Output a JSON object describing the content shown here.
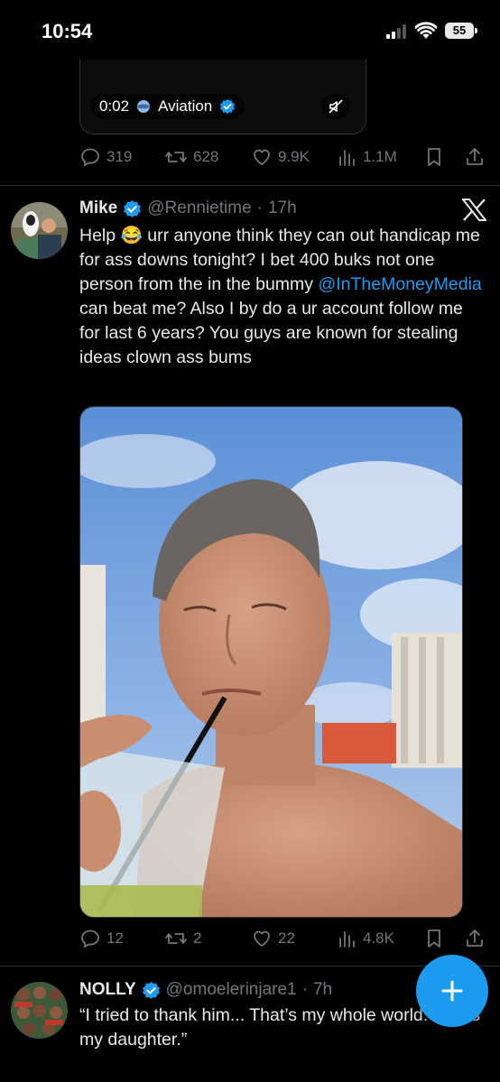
{
  "status_bar": {
    "time": "10:54",
    "battery": "55"
  },
  "video": {
    "time": "0:02",
    "source": "Aviation"
  },
  "actions_top": {
    "replies": "319",
    "reposts": "628",
    "likes": "9.9K",
    "views": "1.1M"
  },
  "tweet": {
    "name": "Mike",
    "handle": "@Rennietime",
    "time": "17h",
    "emoji": "😂",
    "text_1": "Help",
    "text_2": " urr anyone think they can out handicap me  for ass downs tonight? I bet 400 buks not one person from the in the bummy ",
    "mention": "@InTheMoneyMedia",
    "text_3": "  can beat me? Also I by do a ur account follow me for last 6 years? You guys are known for stealing ideas clown ass bums",
    "actions": {
      "replies": "12",
      "reposts": "2",
      "likes": "22",
      "views": "4.8K"
    }
  },
  "reply": {
    "name": "NOLLY",
    "handle": "@omoelerinjare1",
    "time": "7h",
    "text": "“I tried to thank him... That’s my whole world. That’s my daughter.”"
  },
  "colors": {
    "accent": "#1d9bf0",
    "muted": "#71767b",
    "text": "#e7e9ea",
    "background": "#000000"
  }
}
